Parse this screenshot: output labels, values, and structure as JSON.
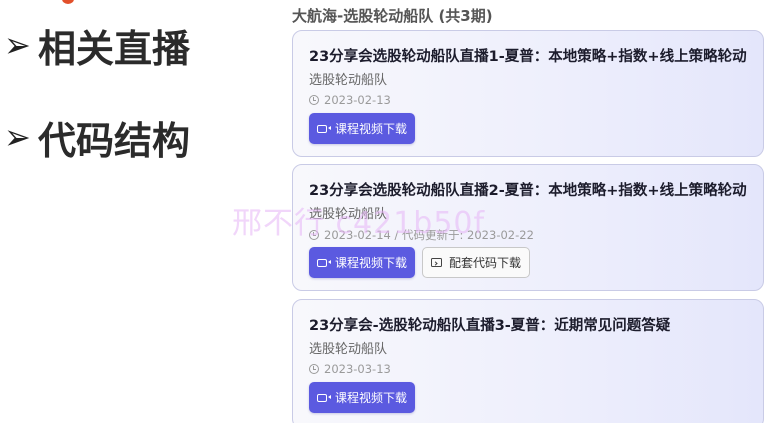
{
  "slide": {
    "bullet_glyph": "➢",
    "bullets": [
      {
        "text": "相关直播"
      },
      {
        "text": "代码结构"
      }
    ],
    "accent_color": "#e2502b"
  },
  "course_group": {
    "title": "大航海-选股轮动船队 (共3期)"
  },
  "cards": [
    {
      "title": "23分享会选股轮动船队直播1-夏普：本地策略+指数+线上策略轮动",
      "team": "选股轮动船队",
      "date": "2023-02-13",
      "buttons": [
        {
          "label": "课程视频下载",
          "icon": "video-camera-icon",
          "style": "primary"
        }
      ]
    },
    {
      "title": "23分享会选股轮动船队直播2-夏普：本地策略+指数+线上策略轮动",
      "team": "选股轮动船队",
      "date": "2023-02-14 / 代码更新于: 2023-02-22",
      "buttons": [
        {
          "label": "课程视频下载",
          "icon": "video-camera-icon",
          "style": "primary"
        },
        {
          "label": "配套代码下载",
          "icon": "code-window-icon",
          "style": "secondary"
        }
      ]
    },
    {
      "title": "23分享会-选股轮动船队直播3-夏普：近期常见问题答疑",
      "team": "选股轮动船队",
      "date": "2023-03-13",
      "buttons": [
        {
          "label": "课程视频下载",
          "icon": "video-camera-icon",
          "style": "primary"
        }
      ]
    }
  ],
  "watermark": {
    "text": "邢不行 c421b50f"
  },
  "colors": {
    "primary_button": "#5b5ae0",
    "card_border": "#c9cbe6"
  }
}
